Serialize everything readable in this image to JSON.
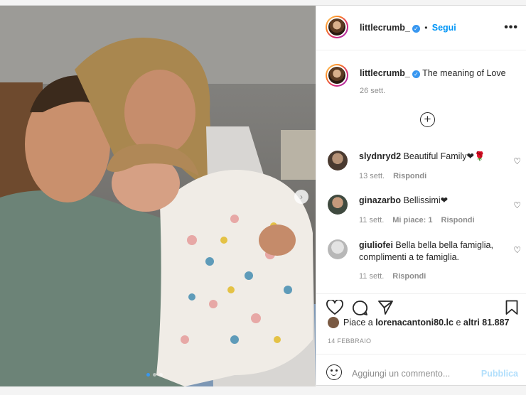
{
  "post": {
    "username": "littlecrumb_",
    "follow_label": "Segui",
    "more_icon": "•••",
    "caption_text": "The meaning of Love",
    "caption_time": "26 sett.",
    "carousel_next": "›"
  },
  "comments": [
    {
      "user": "slydnryd2",
      "text": "Beautiful Family❤🌹",
      "time": "13 sett.",
      "likes": "",
      "reply": "Rispondi"
    },
    {
      "user": "ginazarbo",
      "text": "Bellissimi❤",
      "time": "11 sett.",
      "likes": "Mi piace: 1",
      "reply": "Rispondi"
    },
    {
      "user": "giuliofei",
      "text": "Bella bella bella famiglia, complimenti a te famiglia.",
      "time": "11 sett.",
      "likes": "",
      "reply": "Rispondi"
    }
  ],
  "likes": {
    "prefix": "Piace a",
    "user": "lorenacantoni80.lc",
    "middle": "e",
    "others": "altri 81.887"
  },
  "date_label": "14 FEBBRAIO",
  "add_comment": {
    "placeholder": "Aggiungi un commento...",
    "publish_label": "Pubblica"
  },
  "colors": {
    "accent": "#0095f6",
    "verified": "#3897f0",
    "muted": "#8e8e8e"
  }
}
